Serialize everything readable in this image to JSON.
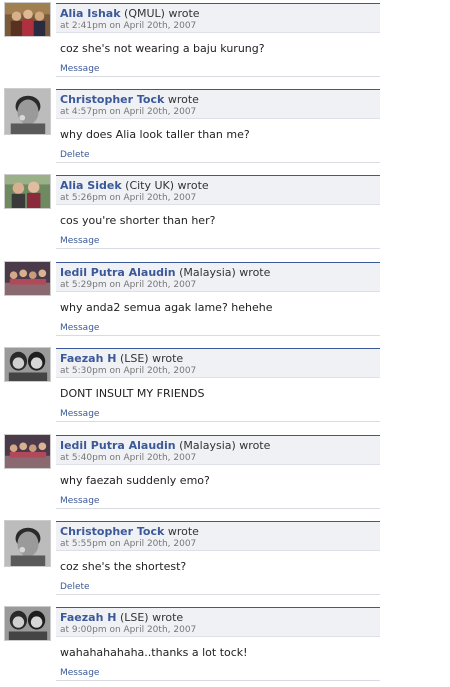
{
  "wall": {
    "posts": [
      {
        "author": "Alia Ishak",
        "affiliation": " (QMUL)",
        "verb": " wrote",
        "time": "at 2:41pm on April 20th, 2007",
        "message": "coz she's not wearing a baju kurung?",
        "action": "Message",
        "avatar_icon": "group-photo-avatar"
      },
      {
        "author": "Christopher Tock",
        "affiliation": "",
        "verb": " wrote",
        "time": "at 4:57pm on April 20th, 2007",
        "message": "why does Alia look taller than me?",
        "action": "Delete",
        "avatar_icon": "portrait-avatar"
      },
      {
        "author": "Alia Sidek",
        "affiliation": " (City UK)",
        "verb": " wrote",
        "time": "at 5:26pm on April 20th, 2007",
        "message": "cos you're shorter than her?",
        "action": "Message",
        "avatar_icon": "group-photo-avatar"
      },
      {
        "author": "Iedil Putra Alaudin",
        "affiliation": " (Malaysia)",
        "verb": " wrote",
        "time": "at 5:29pm on April 20th, 2007",
        "message": "why anda2 semua agak lame? hehehe",
        "action": "Message",
        "avatar_icon": "group-photo-avatar"
      },
      {
        "author": "Faezah H",
        "affiliation": " (LSE)",
        "verb": " wrote",
        "time": "at 5:30pm on April 20th, 2007",
        "message": "DONT INSULT MY FRIENDS",
        "action": "Message",
        "avatar_icon": "pair-photo-avatar"
      },
      {
        "author": "Iedil Putra Alaudin",
        "affiliation": " (Malaysia)",
        "verb": " wrote",
        "time": "at 5:40pm on April 20th, 2007",
        "message": "why faezah suddenly emo?",
        "action": "Message",
        "avatar_icon": "group-photo-avatar"
      },
      {
        "author": "Christopher Tock",
        "affiliation": "",
        "verb": " wrote",
        "time": "at 5:55pm on April 20th, 2007",
        "message": "coz she's the shortest?",
        "action": "Delete",
        "avatar_icon": "portrait-avatar"
      },
      {
        "author": "Faezah H",
        "affiliation": " (LSE)",
        "verb": " wrote",
        "time": "at 9:00pm on April 20th, 2007",
        "message": "wahahahahaha..thanks a lot tock!",
        "action": "Message",
        "avatar_icon": "pair-photo-avatar"
      }
    ]
  },
  "colors": {
    "link": "#3b5998",
    "header_bg": "#f0f1f5",
    "header_border": "#3b5998",
    "meta": "#777777"
  }
}
